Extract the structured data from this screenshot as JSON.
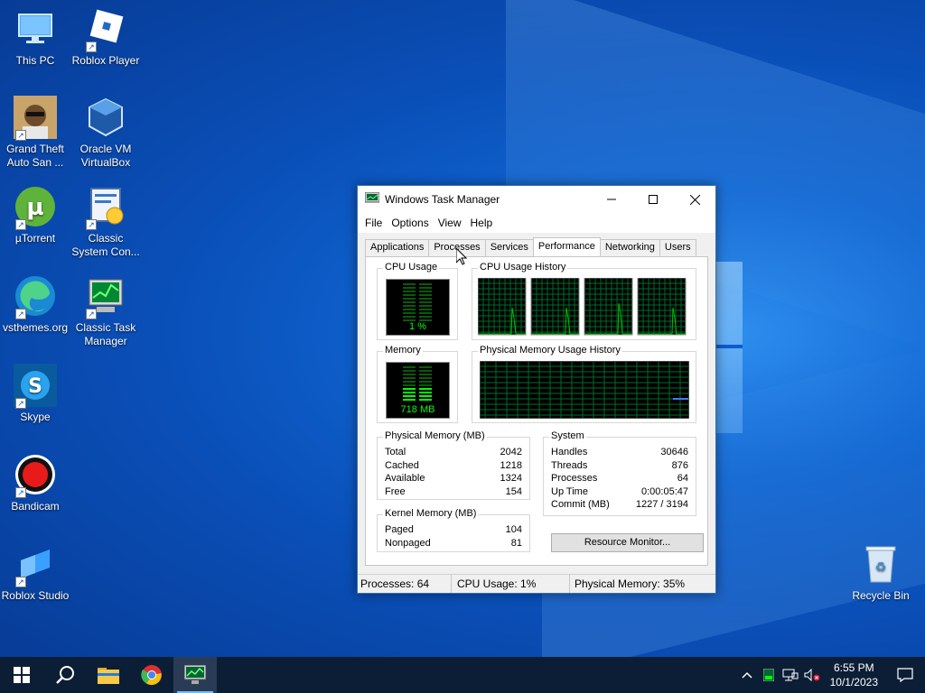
{
  "desktop": {
    "icons": [
      {
        "label": "This PC"
      },
      {
        "label": "Roblox Player"
      },
      {
        "label": "Grand Theft Auto San ..."
      },
      {
        "label": "Oracle VM VirtualBox"
      },
      {
        "label": "µTorrent"
      },
      {
        "label": "Classic System Con..."
      },
      {
        "label": "vsthemes.org"
      },
      {
        "label": "Classic Task Manager"
      },
      {
        "label": "Skype"
      },
      {
        "label": "Bandicam"
      },
      {
        "label": "Roblox Studio"
      },
      {
        "label": "Recycle Bin"
      }
    ]
  },
  "window": {
    "title": "Windows Task Manager",
    "menu": [
      "File",
      "Options",
      "View",
      "Help"
    ],
    "tabs": [
      "Applications",
      "Processes",
      "Services",
      "Performance",
      "Networking",
      "Users"
    ],
    "active_tab": "Performance",
    "cpu_usage_label": "CPU Usage",
    "cpu_usage_value": "1 %",
    "cpu_history_label": "CPU Usage History",
    "memory_label": "Memory",
    "memory_value": "718 MB",
    "memory_history_label": "Physical Memory Usage History",
    "physical_memory": {
      "title": "Physical Memory (MB)",
      "rows": [
        {
          "label": "Total",
          "value": "2042"
        },
        {
          "label": "Cached",
          "value": "1218"
        },
        {
          "label": "Available",
          "value": "1324"
        },
        {
          "label": "Free",
          "value": "154"
        }
      ]
    },
    "kernel_memory": {
      "title": "Kernel Memory (MB)",
      "rows": [
        {
          "label": "Paged",
          "value": "104"
        },
        {
          "label": "Nonpaged",
          "value": "81"
        }
      ]
    },
    "system": {
      "title": "System",
      "rows": [
        {
          "label": "Handles",
          "value": "30646"
        },
        {
          "label": "Threads",
          "value": "876"
        },
        {
          "label": "Processes",
          "value": "64"
        },
        {
          "label": "Up Time",
          "value": "0:00:05:47"
        },
        {
          "label": "Commit (MB)",
          "value": "1227 / 3194"
        }
      ]
    },
    "resource_monitor_button": "Resource Monitor...",
    "status": {
      "processes": "Processes: 64",
      "cpu": "CPU Usage: 1%",
      "memory": "Physical Memory: 35%"
    }
  },
  "taskbar": {
    "time": "6:55 PM",
    "date": "10/1/2023"
  },
  "colors": {
    "graph_green": "#00c000",
    "meter_green": "#00ff00",
    "accent": "#0078d7"
  }
}
